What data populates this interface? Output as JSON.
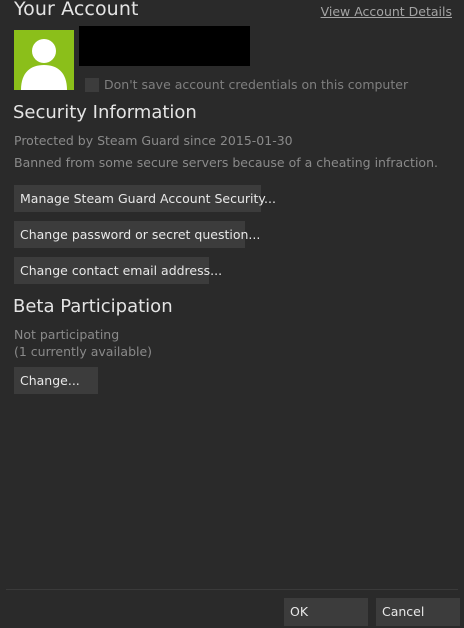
{
  "header": {
    "title": "Your Account",
    "view_details_link": "View Account Details"
  },
  "account": {
    "avatar_icon": "default-user-avatar-icon",
    "avatar_color": "#8bbf1a",
    "name_redacted": true,
    "dont_save_credentials": {
      "label": "Don't save account credentials on this computer",
      "checked": false
    }
  },
  "security": {
    "heading": "Security Information",
    "protected_text": "Protected by Steam Guard since 2015-01-30",
    "ban_text": "Banned from some secure servers because of a cheating infraction.",
    "buttons": {
      "manage_guard": "Manage Steam Guard Account Security...",
      "change_password": "Change password or secret question...",
      "change_email": "Change contact email address..."
    }
  },
  "beta": {
    "heading": "Beta Participation",
    "status": "Not participating",
    "available": "(1 currently available)",
    "change_button": "Change..."
  },
  "footer": {
    "ok": "OK",
    "cancel": "Cancel"
  }
}
